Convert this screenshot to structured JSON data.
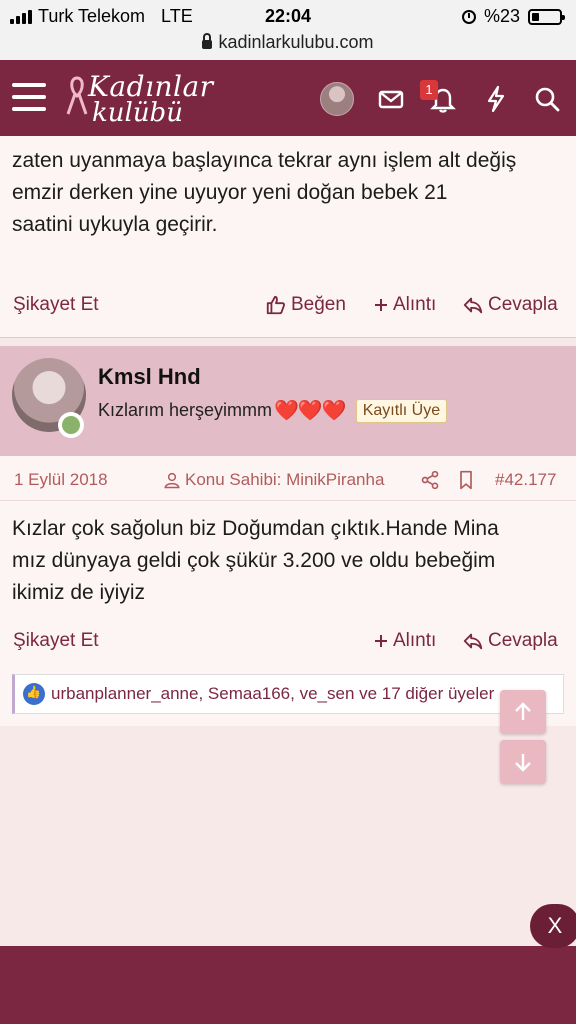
{
  "statusbar": {
    "carrier": "Turk Telekom",
    "network": "LTE",
    "time": "22:04",
    "battery": "%23",
    "battery_level": 0.23
  },
  "browser": {
    "url": "kadinlarkulubu.com"
  },
  "header": {
    "logo_line1": "Kadınlar",
    "logo_line2": "kulübü",
    "notification_count": "1"
  },
  "prev_post": {
    "text_lines": [
      "zaten uyanmaya başlayınca tekrar aynı işlem alt değiş",
      "emzir derken yine uyuyor yeni doğan bebek 21",
      "saatini uykuyla geçirir."
    ],
    "report": "Şikayet Et",
    "like": "Beğen",
    "quote": "Alıntı",
    "reply": "Cevapla"
  },
  "post": {
    "username": "Kmsl Hnd",
    "user_title": "Kızlarım herşeyimmm",
    "hearts": "❤️❤️❤️",
    "badge": "Kayıtlı Üye",
    "date": "1 Eylül 2018",
    "thread_owner": "Konu Sahibi: MinikPiranha",
    "post_number": "#42.177",
    "text_lines": [
      "Kızlar çok sağolun biz Doğumdan çıktık.Hande Mina",
      "mız dünyaya geldi çok şükür 3.200 ve oldu bebeğim",
      "ikimiz de iyiyiz"
    ],
    "report": "Şikayet Et",
    "quote": "Alıntı",
    "reply": "Cevapla",
    "reactions": "urbanplanner_anne, Semaa166, ve_sen ve 17 diğer üyeler"
  },
  "overlay": {
    "close": "X"
  },
  "colors": {
    "brand": "#7b2741",
    "post_header_bg": "#e2bcc6",
    "accent_text": "#b25b5d"
  }
}
